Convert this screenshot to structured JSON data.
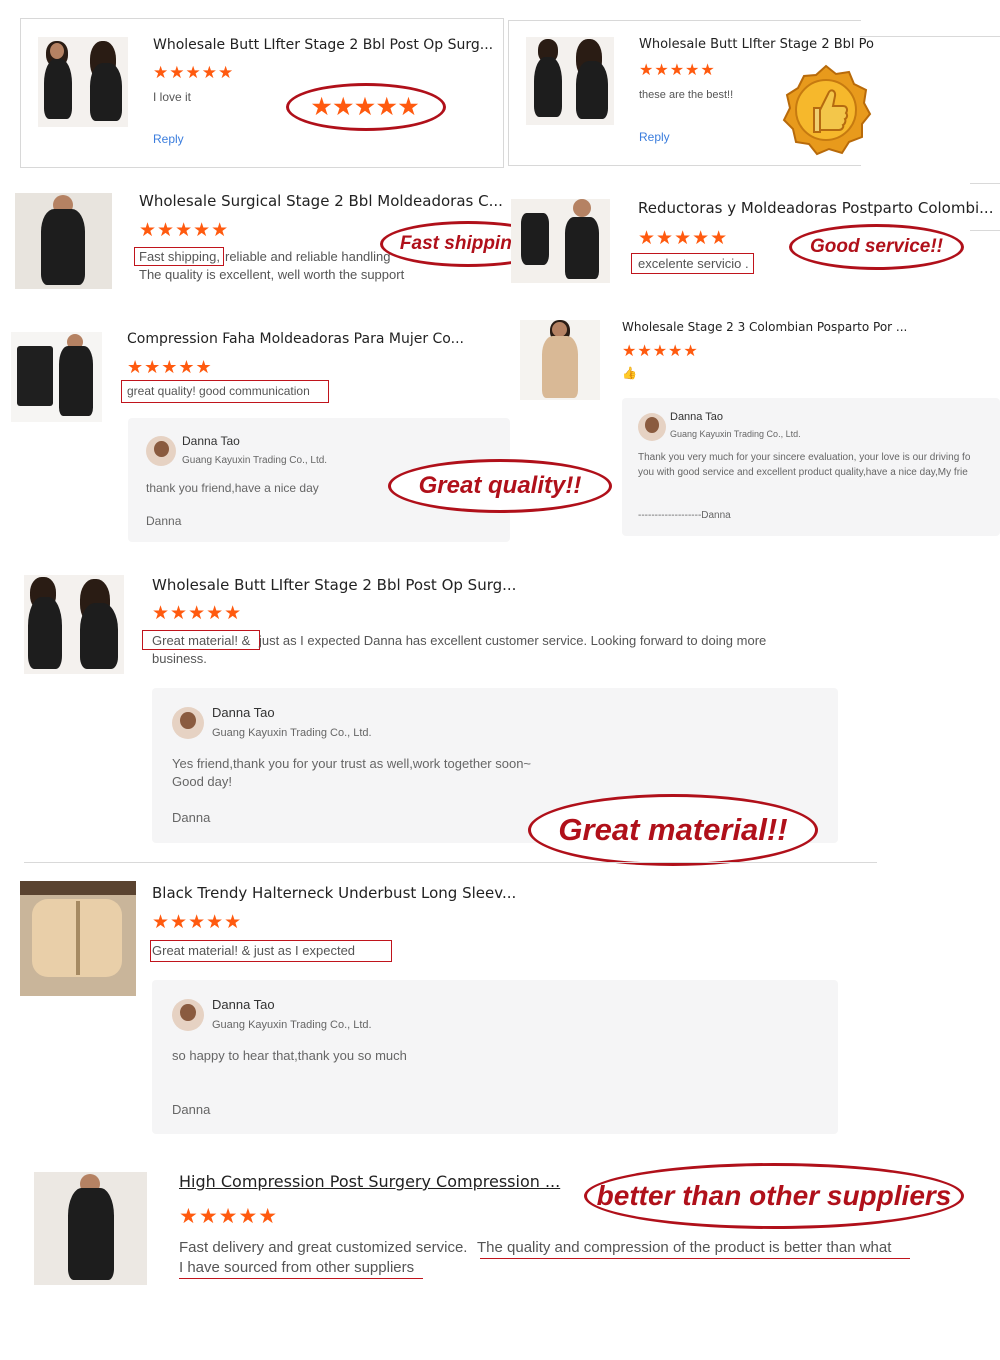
{
  "reviews": [
    {
      "title": "Wholesale Butt LIfter Stage 2 Bbl Post Op Surg...",
      "stars": "★★★★★",
      "text": "I love it",
      "reply": "Reply",
      "bubble": "★★★★★"
    },
    {
      "title": "Wholesale Butt LIfter Stage 2 Bbl Po",
      "stars": "★★★★★",
      "text": "these are the best!!",
      "reply": "Reply"
    },
    {
      "title": "Wholesale Surgical Stage 2 Bbl Moldeadoras C...",
      "stars": "★★★★★",
      "text_a": "Fast shipping,",
      "text_b": "reliable and reliable handling",
      "text_c": "The quality is excellent, well worth the support",
      "bubble": "Fast shipping!!"
    },
    {
      "title": "Reductoras y Moldeadoras Postparto Colombi...",
      "stars": "★★★★★",
      "text": "excelente servicio .",
      "bubble": "Good service!!"
    },
    {
      "title": "Compression Faha Moldeadoras Para Mujer Co...",
      "stars": "★★★★★",
      "text": "great quality! good communication",
      "bubble": "Great quality!!",
      "reply_name": "Danna Tao",
      "reply_company": "Guang Kayuxin Trading Co., Ltd.",
      "reply_text": "thank you friend,have a nice day",
      "reply_sign": "Danna"
    },
    {
      "title": "Wholesale Stage 2 3 Colombian Posparto Por ...",
      "stars": "★★★★★",
      "text": "👍",
      "reply_name": "Danna Tao",
      "reply_company": "Guang Kayuxin Trading Co., Ltd.",
      "reply_text_1": "Thank you very much for your sincere evaluation, your love is our driving fo",
      "reply_text_2": "you with good service and excellent product quality,have a nice day,My frie",
      "reply_sign": "-------------------Danna"
    },
    {
      "title": "Wholesale Butt LIfter Stage 2 Bbl Post Op Surg...",
      "stars": "★★★★★",
      "text_a": "Great material! &",
      "text_b": "just as I expected Danna has excellent customer service. Looking forward to doing more",
      "text_c": "business.",
      "reply_name": "Danna Tao",
      "reply_company": "Guang Kayuxin Trading Co., Ltd.",
      "reply_text_1": "Yes friend,thank you for your trust as well,work together soon~",
      "reply_text_2": "Good day!",
      "reply_sign": "Danna",
      "bubble": "Great material!!"
    },
    {
      "title": "Black Trendy Halterneck Underbust Long Sleev...",
      "stars": "★★★★★",
      "text": "Great material! & just as I expected",
      "reply_name": "Danna Tao",
      "reply_company": "Guang Kayuxin Trading Co., Ltd.",
      "reply_text": "so happy to hear that,thank you so much",
      "reply_sign": "Danna"
    },
    {
      "title": "High Compression Post Surgery Compression ...",
      "stars": "★★★★★",
      "text_a": "Fast delivery and great customized service.",
      "text_b": "The quality and compression of the product is better than what",
      "text_c": "I have sourced from other suppliers",
      "bubble": "better than other suppliers"
    }
  ],
  "colors": {
    "star": "#ff5a0f",
    "accent_red": "#b0101a",
    "link": "#3b7ddd"
  },
  "icons": {
    "thumbs_up": "thumbs-up-badge-icon"
  }
}
